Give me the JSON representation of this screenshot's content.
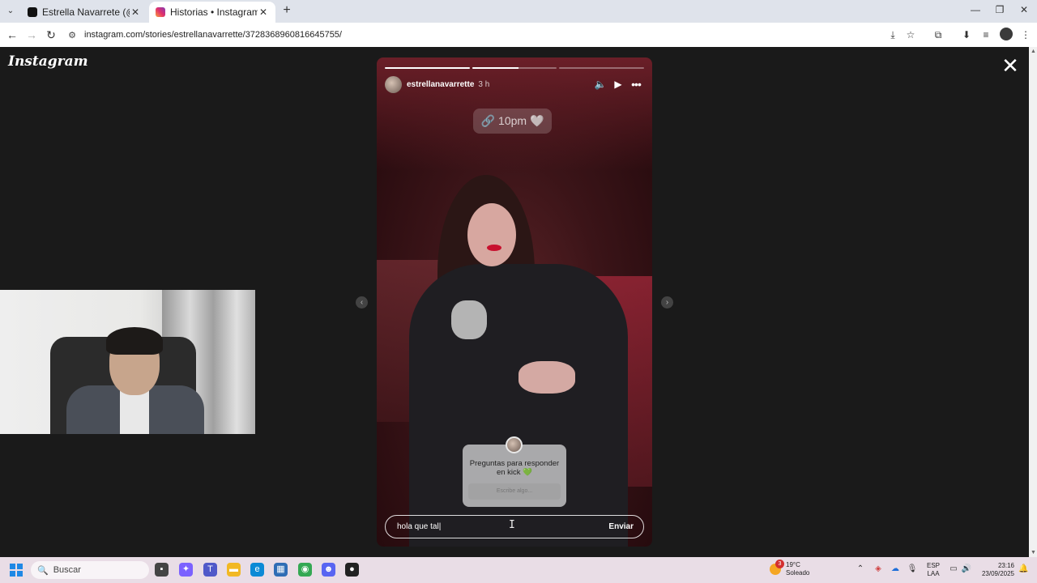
{
  "browser": {
    "tabs": [
      {
        "title": "Estrella Navarrete (@estrellan...",
        "favicon_color": "#111111",
        "active": false
      },
      {
        "title": "Historias • Instagram",
        "favicon_color": "#e1306c",
        "active": true
      }
    ],
    "url": "instagram.com/stories/estrellanavarrette/3728368960816645755/",
    "icons": {
      "tab_menu": "⌄",
      "close_tab": "✕",
      "new_tab": "+",
      "minimize": "—",
      "restore": "❐",
      "close_window": "✕",
      "back": "←",
      "forward": "→",
      "reload": "↻",
      "site_info": "⚙",
      "install": "⤓",
      "bookmark": "☆",
      "extensions": "⧉",
      "downloads": "⬇",
      "media": "≡",
      "menu": "⋮"
    }
  },
  "page": {
    "logo": "Instagram",
    "close_icon": "✕",
    "prev_icon": "‹",
    "next_icon": "›"
  },
  "story": {
    "username": "estrellanavarrette",
    "time": "3 h",
    "progress": [
      1.0,
      0.55,
      0.0
    ],
    "icons": {
      "mute": "🔈",
      "play": "▶",
      "more": "•••"
    },
    "link_sticker": {
      "icon": "🔗",
      "text": "10pm 🤍"
    },
    "question_sticker": {
      "title": "Preguntas para responder en kick 💚",
      "placeholder": "Escribe algo..."
    },
    "reply": {
      "value": "hola que tal",
      "send_label": "Enviar"
    }
  },
  "taskbar": {
    "search_placeholder": "Buscar",
    "search_icon": "🔍",
    "weather": {
      "temp": "19°C",
      "condition": "Soleado",
      "badge": "3"
    },
    "language": {
      "line1": "ESP",
      "line2": "LAA"
    },
    "clock": {
      "time": "23:16",
      "date": "23/09/2025"
    },
    "apps": [
      {
        "name": "file-explorer",
        "glyph": "▪",
        "color": "#444444"
      },
      {
        "name": "copilot",
        "glyph": "✦",
        "color": "#7b61ff"
      },
      {
        "name": "teams",
        "glyph": "T",
        "color": "#5059c9"
      },
      {
        "name": "folder",
        "glyph": "▬",
        "color": "#f2b824"
      },
      {
        "name": "edge",
        "glyph": "e",
        "color": "#0c8ad6"
      },
      {
        "name": "store",
        "glyph": "▦",
        "color": "#2f6db5"
      },
      {
        "name": "chrome",
        "glyph": "◉",
        "color": "#34a853"
      },
      {
        "name": "discord",
        "glyph": "☻",
        "color": "#5865f2"
      },
      {
        "name": "obs",
        "glyph": "●",
        "color": "#222222"
      }
    ]
  }
}
